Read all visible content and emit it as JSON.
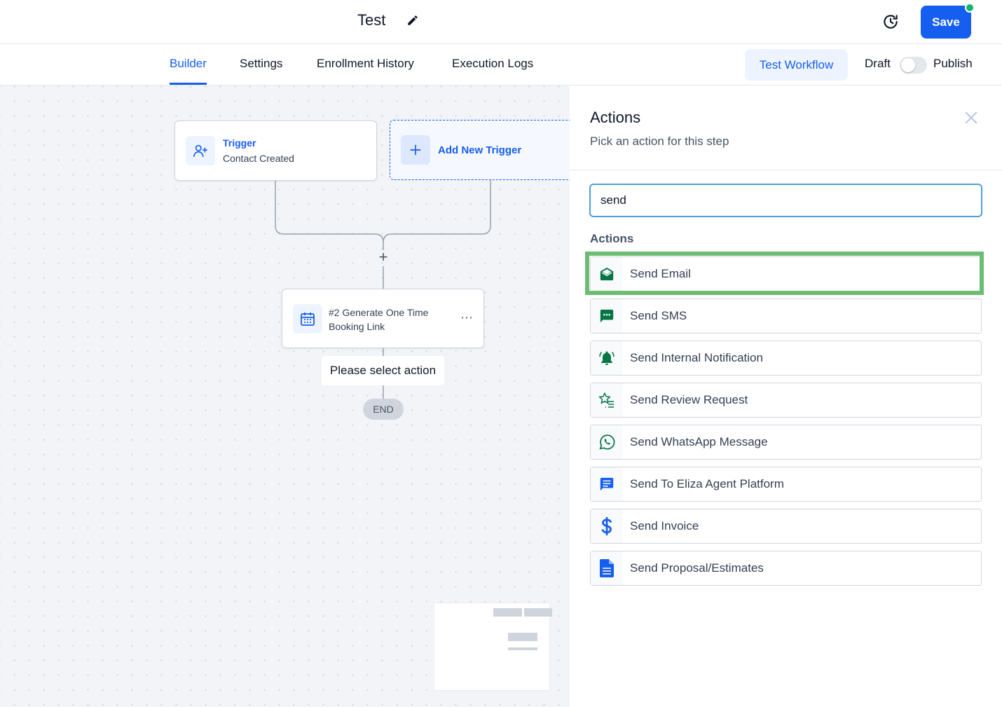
{
  "header": {
    "title": "Test",
    "save_label": "Save"
  },
  "tabs": [
    {
      "label": "Builder",
      "active": true
    },
    {
      "label": "Settings",
      "active": false
    },
    {
      "label": "Enrollment History",
      "active": false
    },
    {
      "label": "Execution Logs",
      "active": false
    }
  ],
  "toolbar": {
    "test_workflow_label": "Test Workflow",
    "draft_label": "Draft",
    "publish_label": "Publish",
    "published": false
  },
  "canvas": {
    "trigger": {
      "title": "Trigger",
      "subtitle": "Contact Created",
      "icon": "user-plus-icon"
    },
    "add_trigger_label": "Add New Trigger",
    "plus_symbol": "+",
    "action_node": {
      "title": "#2 Generate One Time Booking Link",
      "icon": "calendar-icon",
      "more": "⋯"
    },
    "select_action_label": "Please select action",
    "end_label": "END"
  },
  "panel": {
    "title": "Actions",
    "subtitle": "Pick an action for this step",
    "search_value": "send",
    "section_label": "Actions",
    "items": [
      {
        "label": "Send Email",
        "icon": "email-icon",
        "color": "#067647"
      },
      {
        "label": "Send SMS",
        "icon": "sms-icon",
        "color": "#067647"
      },
      {
        "label": "Send Internal Notification",
        "icon": "bell-icon",
        "color": "#067647"
      },
      {
        "label": "Send Review Request",
        "icon": "star-list-icon",
        "color": "#067647"
      },
      {
        "label": "Send WhatsApp Message",
        "icon": "whatsapp-icon",
        "color": "#067647"
      },
      {
        "label": "Send To Eliza Agent Platform",
        "icon": "chat-icon",
        "color": "#155eef"
      },
      {
        "label": "Send Invoice",
        "icon": "dollar-icon",
        "color": "#155eef"
      },
      {
        "label": "Send Proposal/Estimates",
        "icon": "document-icon",
        "color": "#155eef"
      }
    ]
  },
  "colors": {
    "primary": "#155eef",
    "success": "#12b76a",
    "highlight": "#6dbc73"
  }
}
